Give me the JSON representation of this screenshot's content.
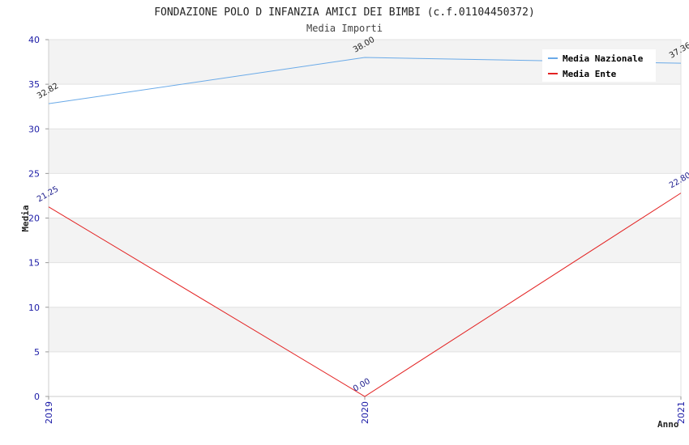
{
  "chart_data": {
    "type": "line",
    "title": "FONDAZIONE POLO D INFANZIA AMICI DEI BIMBI (c.f.01104450372)",
    "subtitle": "Media Importi",
    "xlabel": "Anno",
    "ylabel": "Media",
    "categories": [
      "2019",
      "2020",
      "2021"
    ],
    "ylim": [
      0,
      40
    ],
    "yticks": [
      "0",
      "5",
      "10",
      "15",
      "20",
      "25",
      "30",
      "35",
      "40"
    ],
    "grid": true,
    "legend_position": "top-right",
    "series": [
      {
        "name": "Media Nazionale",
        "color": "#6aaae8",
        "label_color": "#222222",
        "values": [
          32.82,
          38.0,
          37.36
        ],
        "labels": [
          "32.82",
          "38.00",
          "37.36"
        ]
      },
      {
        "name": "Media Ente",
        "color": "#e32222",
        "label_color": "#1a1a8c",
        "values": [
          21.25,
          0.0,
          22.8
        ],
        "labels": [
          "21.25",
          "0.00",
          "22.80"
        ]
      }
    ]
  }
}
